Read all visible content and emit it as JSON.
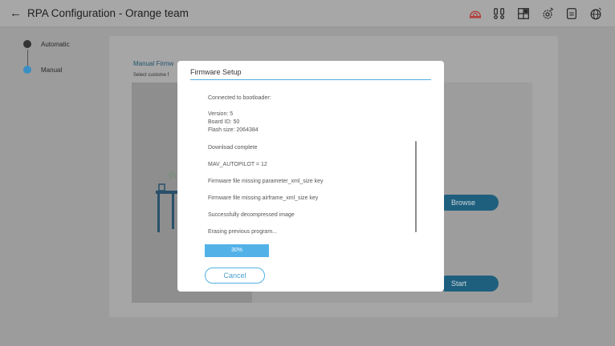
{
  "header": {
    "title": "RPA Configuration - Orange team",
    "toolbar_icons": [
      "alarm-icon",
      "vehicle-setup-icon",
      "dashboard-icon",
      "settings-gear-icon",
      "document-icon",
      "globe-icon"
    ]
  },
  "stepper": {
    "steps": [
      {
        "label": "Automatic",
        "state": "done"
      },
      {
        "label": "Manual",
        "state": "active"
      }
    ]
  },
  "panel": {
    "heading": "Manual Firmw",
    "subheading": "Select custome f",
    "browse_label": "Browse",
    "start_label": "Start"
  },
  "modal": {
    "title": "Firmware Setup",
    "log": [
      "Connected to bootloader:",
      "Version: 5",
      "Board ID: 50",
      "Flash size: 2064384",
      "Download complete",
      "MAV_AUTOPILOT = 12",
      "Firmware file missing parameter_xml_size key",
      "Firmware file missing airframe_xml_size key",
      "Successfully decompressed image",
      "Erasing previous program..."
    ],
    "progress_percent": 30,
    "progress_label": "30%",
    "cancel_label": "Cancel"
  },
  "colors": {
    "accent": "#52b2e8",
    "active_step": "#3a8fc4",
    "dark_button": "#1f5f7e"
  }
}
